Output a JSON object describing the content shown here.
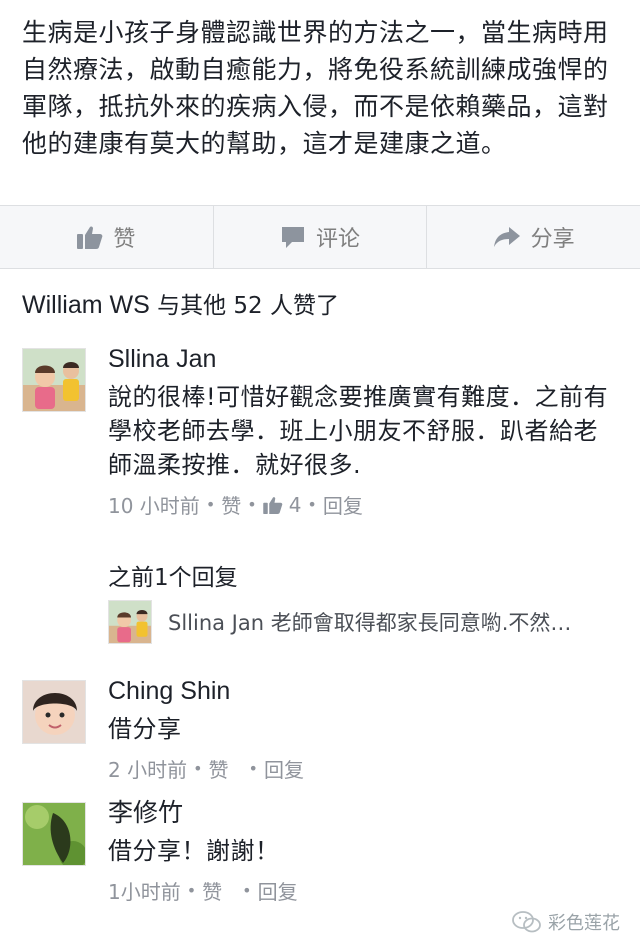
{
  "post": {
    "text": "生病是小孩子身體認識世界的方法之一，當生病時用自然療法，啟動自癒能力，將免役系統訓練成強悍的軍隊，抵抗外來的疾病入侵，而不是依賴藥品，這對他的建康有莫大的幫助，這才是建康之道。"
  },
  "actions": {
    "like_label": "赞",
    "comment_label": "评论",
    "share_label": "分享"
  },
  "likes": {
    "name": "William WS",
    "rest": " 与其他 52 人赞了"
  },
  "comments": [
    {
      "name": "Sllina Jan",
      "text": "說的很棒!可惜好觀念要推廣實有難度．之前有學校老師去學．班上小朋友不舒服．趴者給老師溫柔按推．就好很多.",
      "time": "10 小时前",
      "like_label": "赞",
      "like_count": "4",
      "reply_label": "回复"
    },
    {
      "name": "Ching Shin",
      "text": "借分享",
      "time": "2 小时前",
      "like_label": "赞",
      "reply_label": "回复"
    },
    {
      "name": "李修竹",
      "text": "借分享！謝謝！",
      "time": "1小时前",
      "like_label": "赞",
      "reply_label": "回复"
    }
  ],
  "previous_replies": {
    "label": "之前1个回复",
    "reply_name": "Sllina Jan",
    "reply_text": "老師會取得都家長同意喲.不然…"
  },
  "watermark": {
    "text": "彩色莲花"
  },
  "icons": {
    "like": "thumbs-up-icon",
    "comment": "speech-bubble-icon",
    "share": "share-arrow-icon",
    "watermark": "wechat-icon"
  },
  "colors": {
    "text": "#1d2129",
    "meta": "#90949c",
    "action_bar_bg": "#f6f7f9",
    "icon": "#8d949e"
  }
}
